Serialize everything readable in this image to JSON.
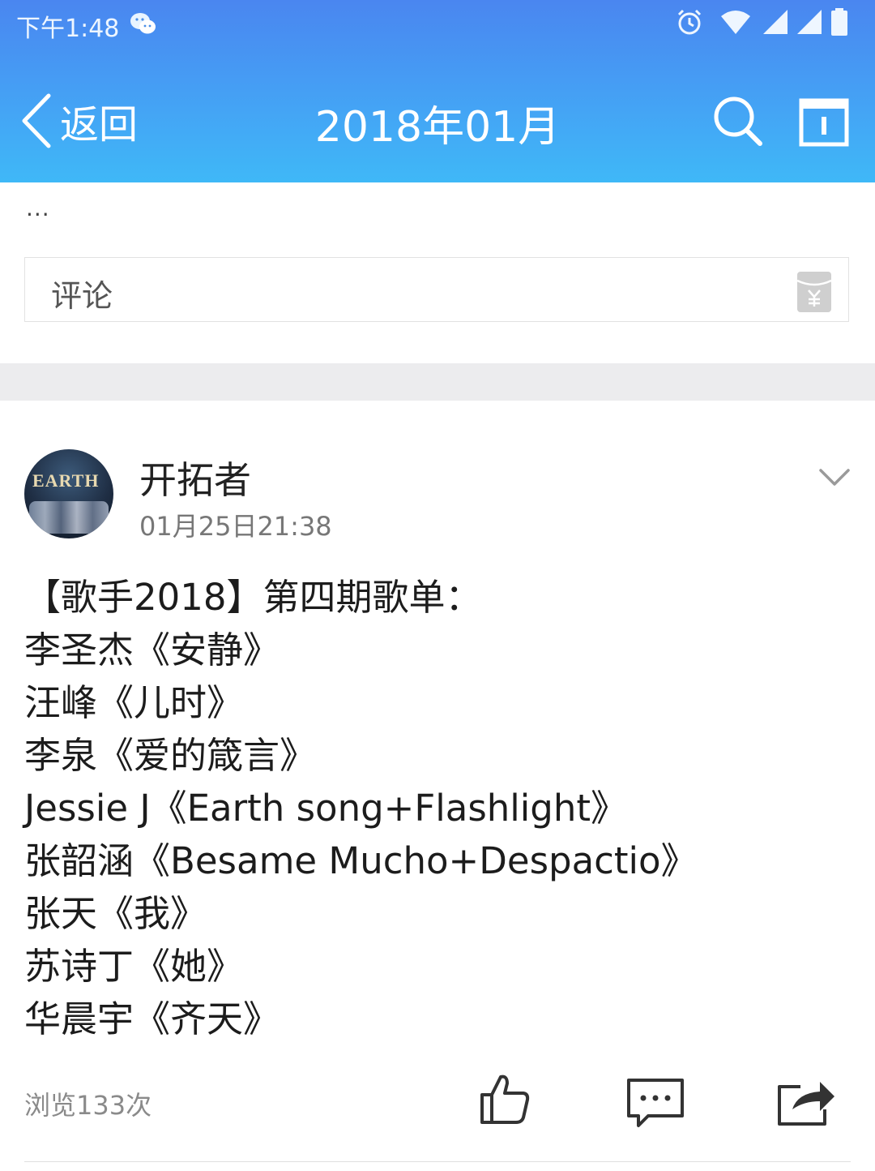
{
  "status_bar": {
    "time": "下午1:48"
  },
  "nav": {
    "back_label": "返回",
    "title": "2018年01月"
  },
  "comment": {
    "ellipsis": "...",
    "placeholder": "评论"
  },
  "post": {
    "author": "开拓者",
    "date": "01月25日21:38",
    "avatar_text": "EARTH",
    "lines": [
      "【歌手2018】第四期歌单：",
      "李圣杰《安静》",
      "汪峰《儿时》",
      "李泉《爱的箴言》",
      "Jessie J《Earth song+Flashlight》",
      "张韶涵《Besame Mucho+Despactio》",
      "张天《我》",
      "苏诗丁《她》",
      "华晨宇《齐天》"
    ],
    "views": "浏览133次"
  },
  "icons": {
    "status": [
      "wechat-icon",
      "alarm-icon",
      "wifi-icon",
      "signal-icon",
      "battery-icon"
    ],
    "nav": [
      "chevron-left-icon",
      "search-icon",
      "calendar-icon"
    ],
    "actions": [
      "thumbs-up-icon",
      "comment-icon",
      "share-icon"
    ]
  },
  "colors": {
    "header_top": "#4a86f0",
    "header_bottom": "#3fb8f7",
    "band": "#ececee"
  }
}
